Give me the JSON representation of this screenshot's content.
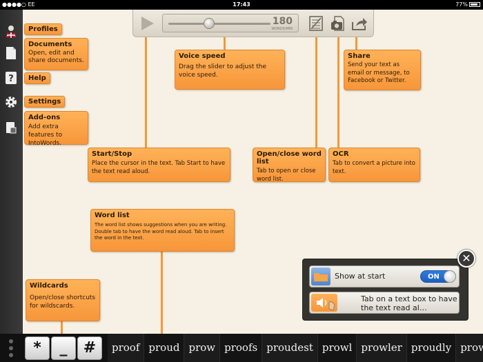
{
  "status": {
    "carrier": "EE",
    "time": "17:43",
    "battery": "77%"
  },
  "sidebar": {
    "items": [
      {
        "icon": "profile-icon",
        "label": "Profiles"
      },
      {
        "icon": "document-icon",
        "label": "Documents",
        "desc": "Open, edit and share documents."
      },
      {
        "icon": "help-icon",
        "label": "Help"
      },
      {
        "icon": "gear-icon",
        "label": "Settings"
      },
      {
        "icon": "addon-icon",
        "label": "Add-ons",
        "desc": "Add extra features to IntoWords."
      }
    ]
  },
  "toolbar": {
    "speed_value": "180",
    "speed_unit": "WORDS/MIN",
    "speed_fraction": 0.4
  },
  "callouts": {
    "voice_speed": {
      "title": "Voice speed",
      "text": "Drag the slider to adjust the voice speed."
    },
    "share": {
      "title": "Share",
      "text": "Send your text as email or message, to Facebook or Twitter."
    },
    "start_stop": {
      "title": "Start/Stop",
      "text": "Place the cursor in the text. Tab Start to have the text read aloud."
    },
    "word_list_toggle": {
      "title": "Open/close word list",
      "text": "Tab to open or close word list."
    },
    "ocr": {
      "title": "OCR",
      "text": "Tab to convert a picture into text."
    },
    "word_list": {
      "title": "Word list",
      "text": "The word list shows suggestions when you are writing. Double tab to have the word read aloud. Tab to insert the word in the text."
    },
    "wildcards": {
      "title": "Wildcards",
      "text": "Open/close shortcuts for wildscards."
    }
  },
  "hint_panel": {
    "show_at_start": "Show at start",
    "toggle_label": "ON",
    "toggle_on": true,
    "tap_hint": "Tab on a text box to have the text read al…"
  },
  "bottom": {
    "wildcard_buttons": [
      "*",
      "_",
      "#"
    ],
    "words": [
      "proof",
      "proud",
      "prow",
      "proofs",
      "proudest",
      "prowl",
      "prowler",
      "proudly",
      "prowe"
    ]
  },
  "colors": {
    "accent": "#f7963a",
    "toggle": "#2f7de0",
    "sidebar": "#333333",
    "paper": "#f6f1e4"
  }
}
